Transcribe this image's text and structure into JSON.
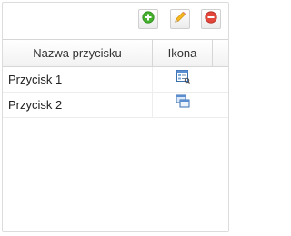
{
  "toolbar": {
    "buttons": [
      {
        "icon": "add-icon",
        "color": "#3fae2a"
      },
      {
        "icon": "pencil-icon",
        "color": "#f2b51c"
      },
      {
        "icon": "remove-icon",
        "color": "#e0463a"
      }
    ]
  },
  "grid": {
    "columns": [
      "Nazwa przycisku",
      "Ikona"
    ],
    "rows": [
      {
        "name": "Przycisk 1",
        "icon": "list-form-icon"
      },
      {
        "name": "Przycisk 2",
        "icon": "windows-stack-icon"
      }
    ]
  }
}
